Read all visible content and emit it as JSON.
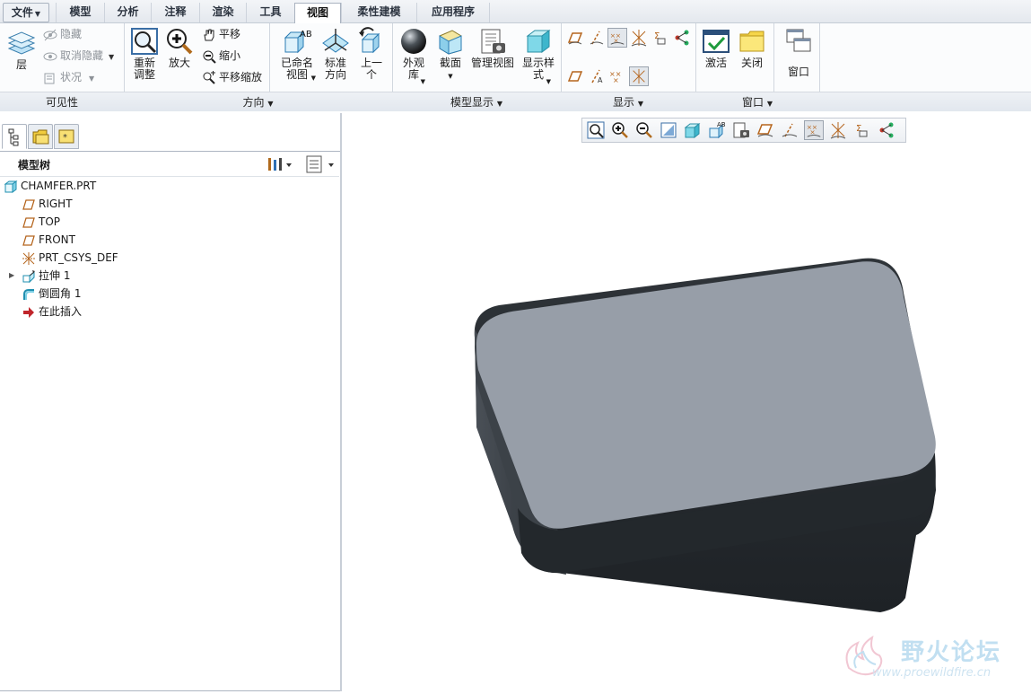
{
  "menu": {
    "file_label": "文件",
    "tabs": [
      "模型",
      "分析",
      "注释",
      "渲染",
      "工具",
      "视图",
      "柔性建模",
      "应用程序"
    ],
    "active_tab": "视图"
  },
  "ribbon": {
    "visibility": {
      "layer_label": "层",
      "hide_label": "隐藏",
      "unhide_label": "取消隐藏",
      "status_label": "状况",
      "group_label": "可见性"
    },
    "orientation": {
      "refit_label": "重新\n调整",
      "zoom_in_label": "放大",
      "pan_label": "平移",
      "zoom_out_label": "缩小",
      "pan_zoom_label": "平移缩放",
      "named_views_label": "已命名\n视图",
      "standard_orientation_label": "标准\n方向",
      "previous_label": "上一\n个",
      "group_label": "方向"
    },
    "model_display": {
      "appearance_label": "外观\n库",
      "section_label": "截面",
      "view_manager_label": "管理视图",
      "display_style_label": "显示样\n式",
      "group_label": "模型显示"
    },
    "show": {
      "group_label": "显示"
    },
    "window": {
      "activate_label": "激活",
      "close_label": "关闭",
      "windows_label": "窗口",
      "group_label": "窗口"
    }
  },
  "model_tree": {
    "title": "模型树",
    "items": [
      {
        "label": "CHAMFER.PRT",
        "icon": "part-icon"
      },
      {
        "label": "RIGHT",
        "icon": "datum-plane-icon"
      },
      {
        "label": "TOP",
        "icon": "datum-plane-icon"
      },
      {
        "label": "FRONT",
        "icon": "datum-plane-icon"
      },
      {
        "label": "PRT_CSYS_DEF",
        "icon": "csys-icon"
      },
      {
        "label": "拉伸 1",
        "icon": "extrude-icon"
      },
      {
        "label": "倒圆角 1",
        "icon": "round-icon"
      },
      {
        "label": "在此插入",
        "icon": "insert-here-icon"
      }
    ]
  },
  "watermark": {
    "title": "野火论坛",
    "url": "www.proewildfire.cn"
  }
}
